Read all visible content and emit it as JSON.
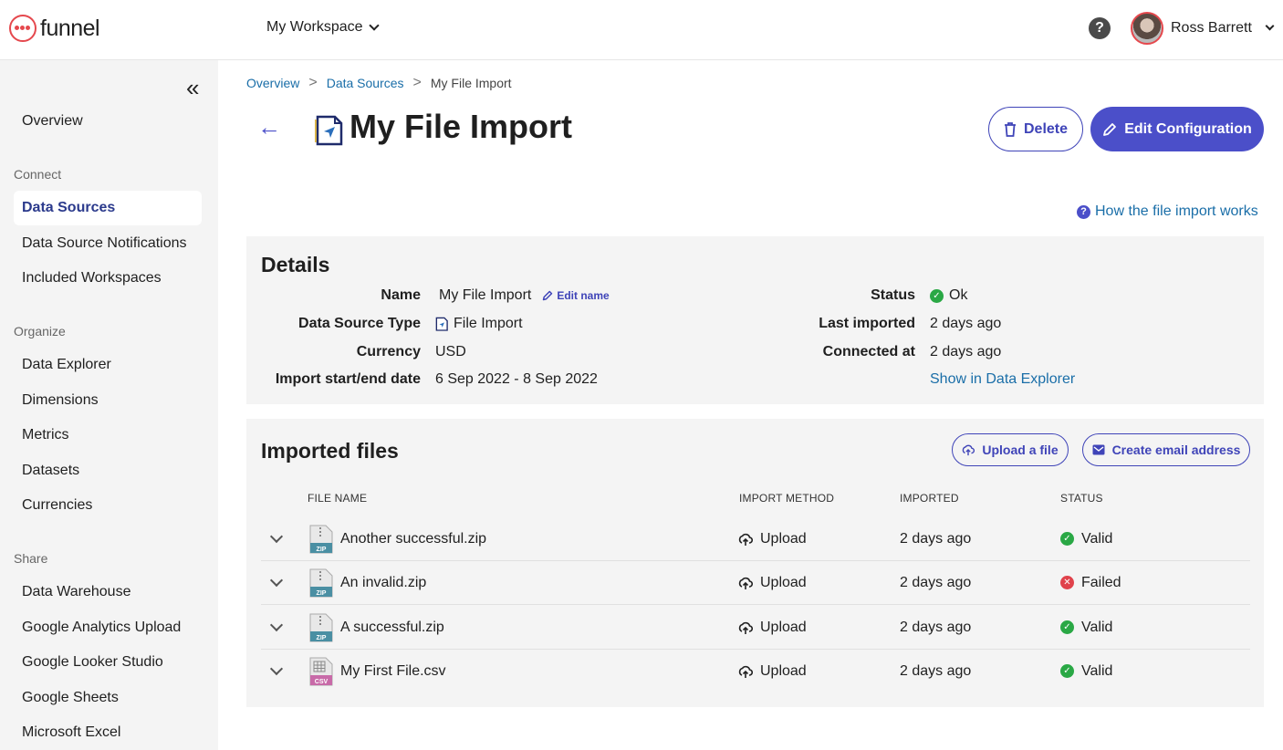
{
  "header": {
    "logo_text": "funnel",
    "workspace": "My Workspace",
    "user_name": "Ross Barrett",
    "help_glyph": "?"
  },
  "sidebar": {
    "collapse_glyph": "«",
    "overview": "Overview",
    "sections": [
      {
        "heading": "Connect",
        "items": [
          "Data Sources",
          "Data Source Notifications",
          "Included Workspaces"
        ]
      },
      {
        "heading": "Organize",
        "items": [
          "Data Explorer",
          "Dimensions",
          "Metrics",
          "Datasets",
          "Currencies"
        ]
      },
      {
        "heading": "Share",
        "items": [
          "Data Warehouse",
          "Google Analytics Upload",
          "Google Looker Studio",
          "Google Sheets",
          "Microsoft Excel"
        ]
      }
    ],
    "active_item": "Data Sources"
  },
  "breadcrumb": {
    "items": [
      "Overview",
      "Data Sources"
    ],
    "current": "My File Import",
    "separator": ">"
  },
  "page": {
    "title": "My File Import",
    "back_glyph": "←",
    "delete_label": "Delete",
    "edit_label": "Edit Configuration",
    "howto_label": "How the file import works"
  },
  "details": {
    "heading": "Details",
    "left": [
      {
        "label": "Name",
        "value": "My File Import"
      },
      {
        "label": "Data Source Type",
        "value": "File Import"
      },
      {
        "label": "Currency",
        "value": "USD"
      },
      {
        "label": "Import start/end date",
        "value": "6 Sep 2022 - 8 Sep 2022"
      }
    ],
    "edit_name_label": "Edit name",
    "right": [
      {
        "label": "Status",
        "value": "Ok"
      },
      {
        "label": "Last imported",
        "value": "2 days ago"
      },
      {
        "label": "Connected at",
        "value": "2 days ago"
      }
    ],
    "explorer_link": "Show in Data Explorer"
  },
  "files": {
    "heading": "Imported files",
    "upload_label": "Upload a file",
    "email_label": "Create email address",
    "columns": [
      "FILE NAME",
      "IMPORT METHOD",
      "IMPORTED",
      "STATUS"
    ],
    "rows": [
      {
        "name": "Another successful.zip",
        "type": "ZIP",
        "method": "Upload",
        "imported": "2 days ago",
        "status": "Valid"
      },
      {
        "name": "An invalid.zip",
        "type": "ZIP",
        "method": "Upload",
        "imported": "2 days ago",
        "status": "Failed"
      },
      {
        "name": "A successful.zip",
        "type": "ZIP",
        "method": "Upload",
        "imported": "2 days ago",
        "status": "Valid"
      },
      {
        "name": "My First File.csv",
        "type": "CSV",
        "method": "Upload",
        "imported": "2 days ago",
        "status": "Valid"
      }
    ]
  },
  "colors": {
    "brand_red": "#e5484d",
    "primary": "#4b4fc9",
    "link": "#1a6ea8",
    "valid": "#2aa845",
    "failed": "#e0424b",
    "zip_badge": "#4a8fa3",
    "csv_badge": "#c86aa8"
  }
}
